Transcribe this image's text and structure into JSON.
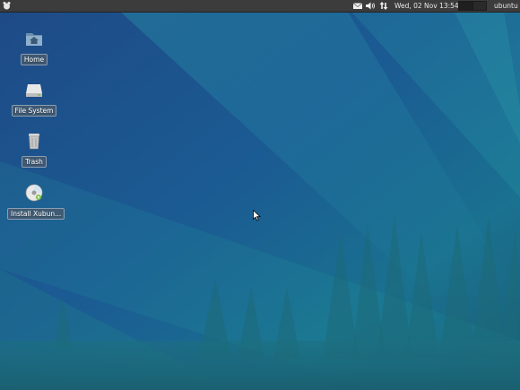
{
  "panel": {
    "clock": "Wed, 02 Nov 13:54",
    "user": "ubuntu",
    "tray_icons": [
      "mail-icon",
      "volume-icon",
      "network-icon"
    ]
  },
  "desktop_icons": [
    {
      "label": "Home",
      "icon": "home-folder-icon"
    },
    {
      "label": "File System",
      "icon": "drive-icon"
    },
    {
      "label": "Trash",
      "icon": "trash-icon"
    },
    {
      "label": "Install Xubun...",
      "icon": "install-disc-icon"
    }
  ],
  "colors": {
    "panel_bg": "#3c3c3c",
    "wallpaper_blue": "#1f4f86",
    "wallpaper_teal": "#1a6d8c"
  }
}
